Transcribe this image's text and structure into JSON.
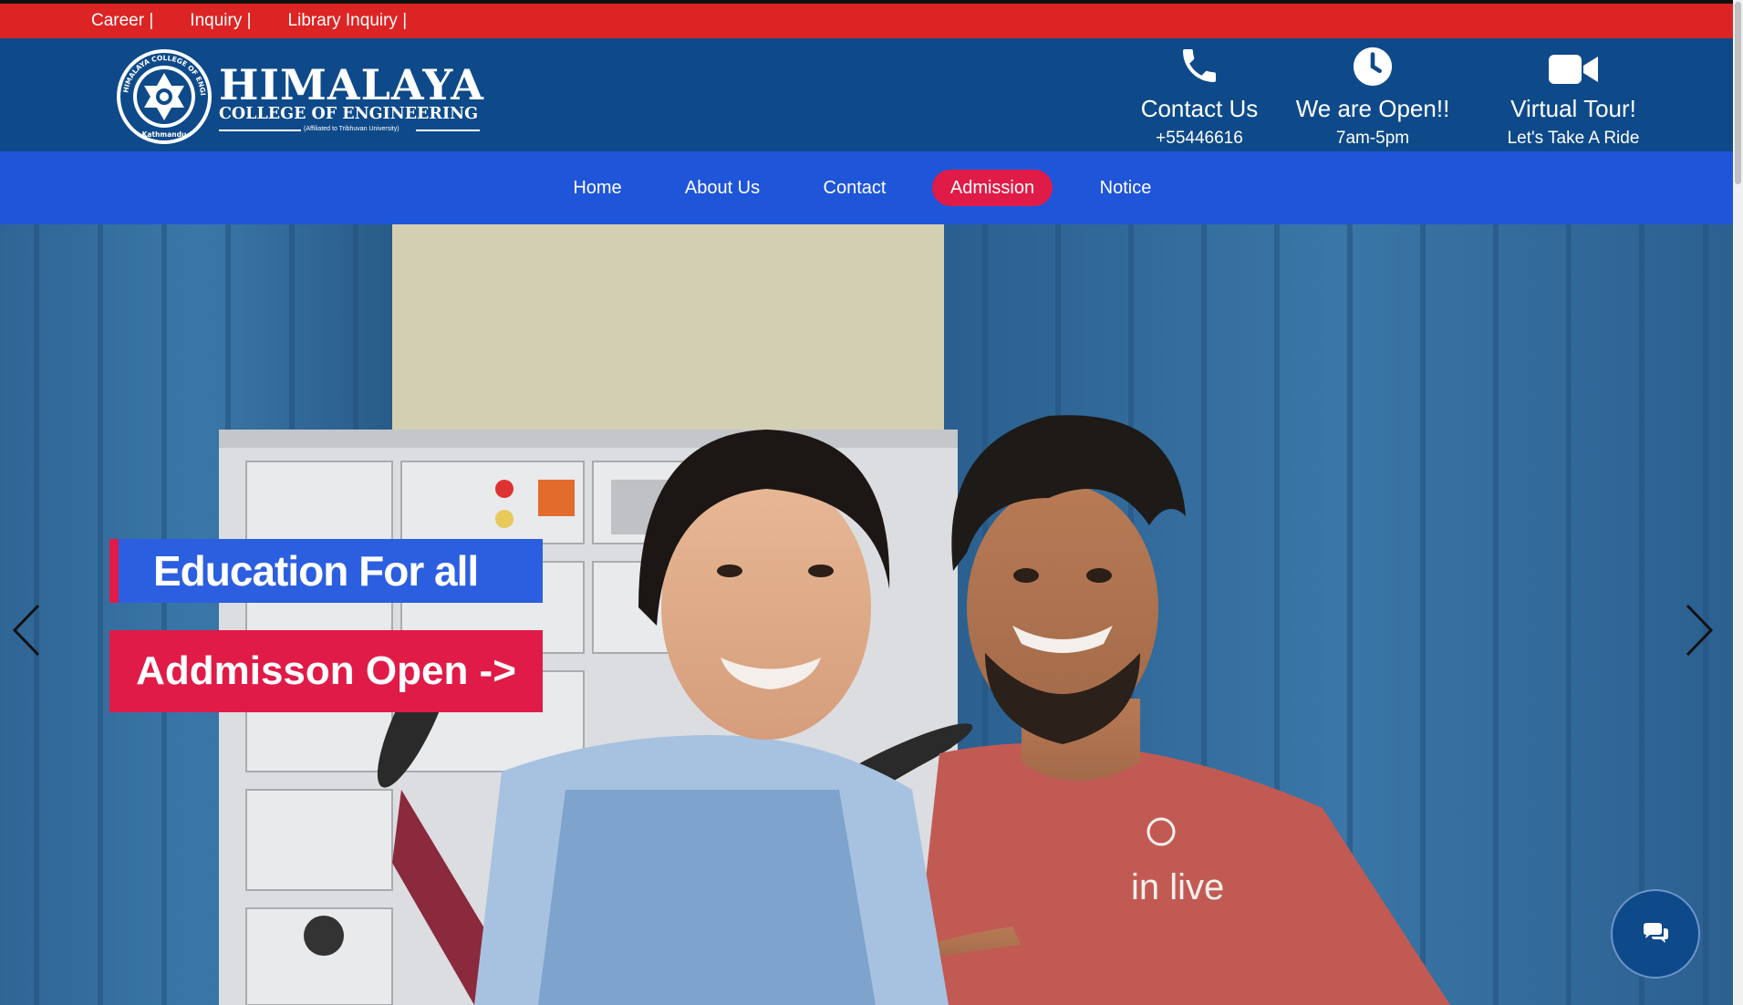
{
  "top_links": [
    "Career |",
    "Inquiry |",
    "Library Inquiry |"
  ],
  "logo": {
    "name": "HIMALAYA",
    "subtitle": "COLLEGE OF ENGINEERING",
    "affiliation": "(Affiliated to Tribhuvan University)",
    "seal_text": "HIMALAYA COLLEGE OF ENGINEERING",
    "seal_bottom": "Kathmandu"
  },
  "header_info": [
    {
      "icon": "phone-icon",
      "title": "Contact Us",
      "sub": "+55446616"
    },
    {
      "icon": "clock-icon",
      "title": "We are Open!!",
      "sub": "7am-5pm"
    },
    {
      "icon": "video-camera-icon",
      "title": "Virtual Tour!",
      "sub": "Let's Take A Ride"
    }
  ],
  "nav": {
    "items": [
      "Home",
      "About Us",
      "Contact",
      "Admission",
      "Notice"
    ],
    "active": "Admission"
  },
  "hero": {
    "tagline": "Education For all",
    "cta": "Addmisson Open ->",
    "tshirt_text": "in live"
  },
  "colors": {
    "topbar": "#dd2424",
    "header": "#0e4a8a",
    "nav": "#1f55d9",
    "accent": "#e01b48",
    "tag_blue": "#2c5fe0"
  }
}
